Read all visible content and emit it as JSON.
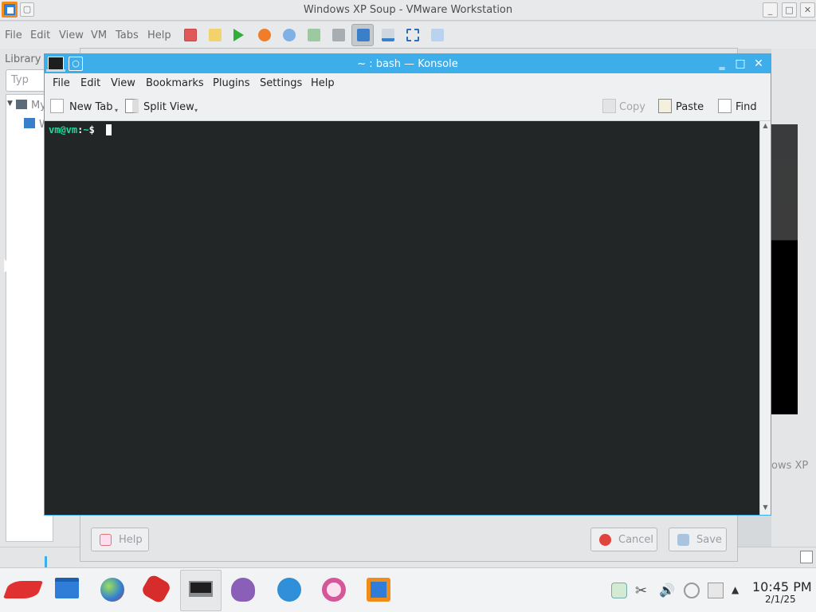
{
  "vmware": {
    "title": "Windows XP Soup - VMware Workstation",
    "menu": [
      "File",
      "Edit",
      "View",
      "VM",
      "Tabs",
      "Help"
    ],
    "library_label": "Library",
    "search_placeholder": "Typ",
    "tree": [
      {
        "label": "My"
      },
      {
        "label": "W"
      }
    ],
    "vm_label": "ows XP",
    "controls": {
      "minimize": "_",
      "maximize": "□",
      "close": "✕"
    }
  },
  "dialog": {
    "help_label": "Help",
    "cancel_label": "Cancel",
    "save_label": "Save"
  },
  "konsole": {
    "title": "~ : bash — Konsole",
    "menu": [
      "File",
      "Edit",
      "View",
      "Bookmarks",
      "Plugins",
      "Settings",
      "Help"
    ],
    "toolbar": {
      "new_tab": "New Tab",
      "split_view": "Split View",
      "copy": "Copy",
      "paste": "Paste",
      "find": "Find"
    },
    "prompt_user": "vm@vm",
    "prompt_sep": ":",
    "prompt_path": "~",
    "prompt_symbol": "$"
  },
  "taskbar": {
    "apps": [
      "start-menu-icon",
      "file-manager-icon",
      "browser-icon",
      "games-icon",
      "terminal-icon",
      "pidgin-icon",
      "kde-connect-icon",
      "media-player-icon",
      "vmware-icon"
    ],
    "time": "10:45 PM",
    "date": "2/1/25"
  },
  "colors": {
    "accent": "#3daee9",
    "terminal_bg": "#232627",
    "prompt_green": "#1cdc9a"
  }
}
